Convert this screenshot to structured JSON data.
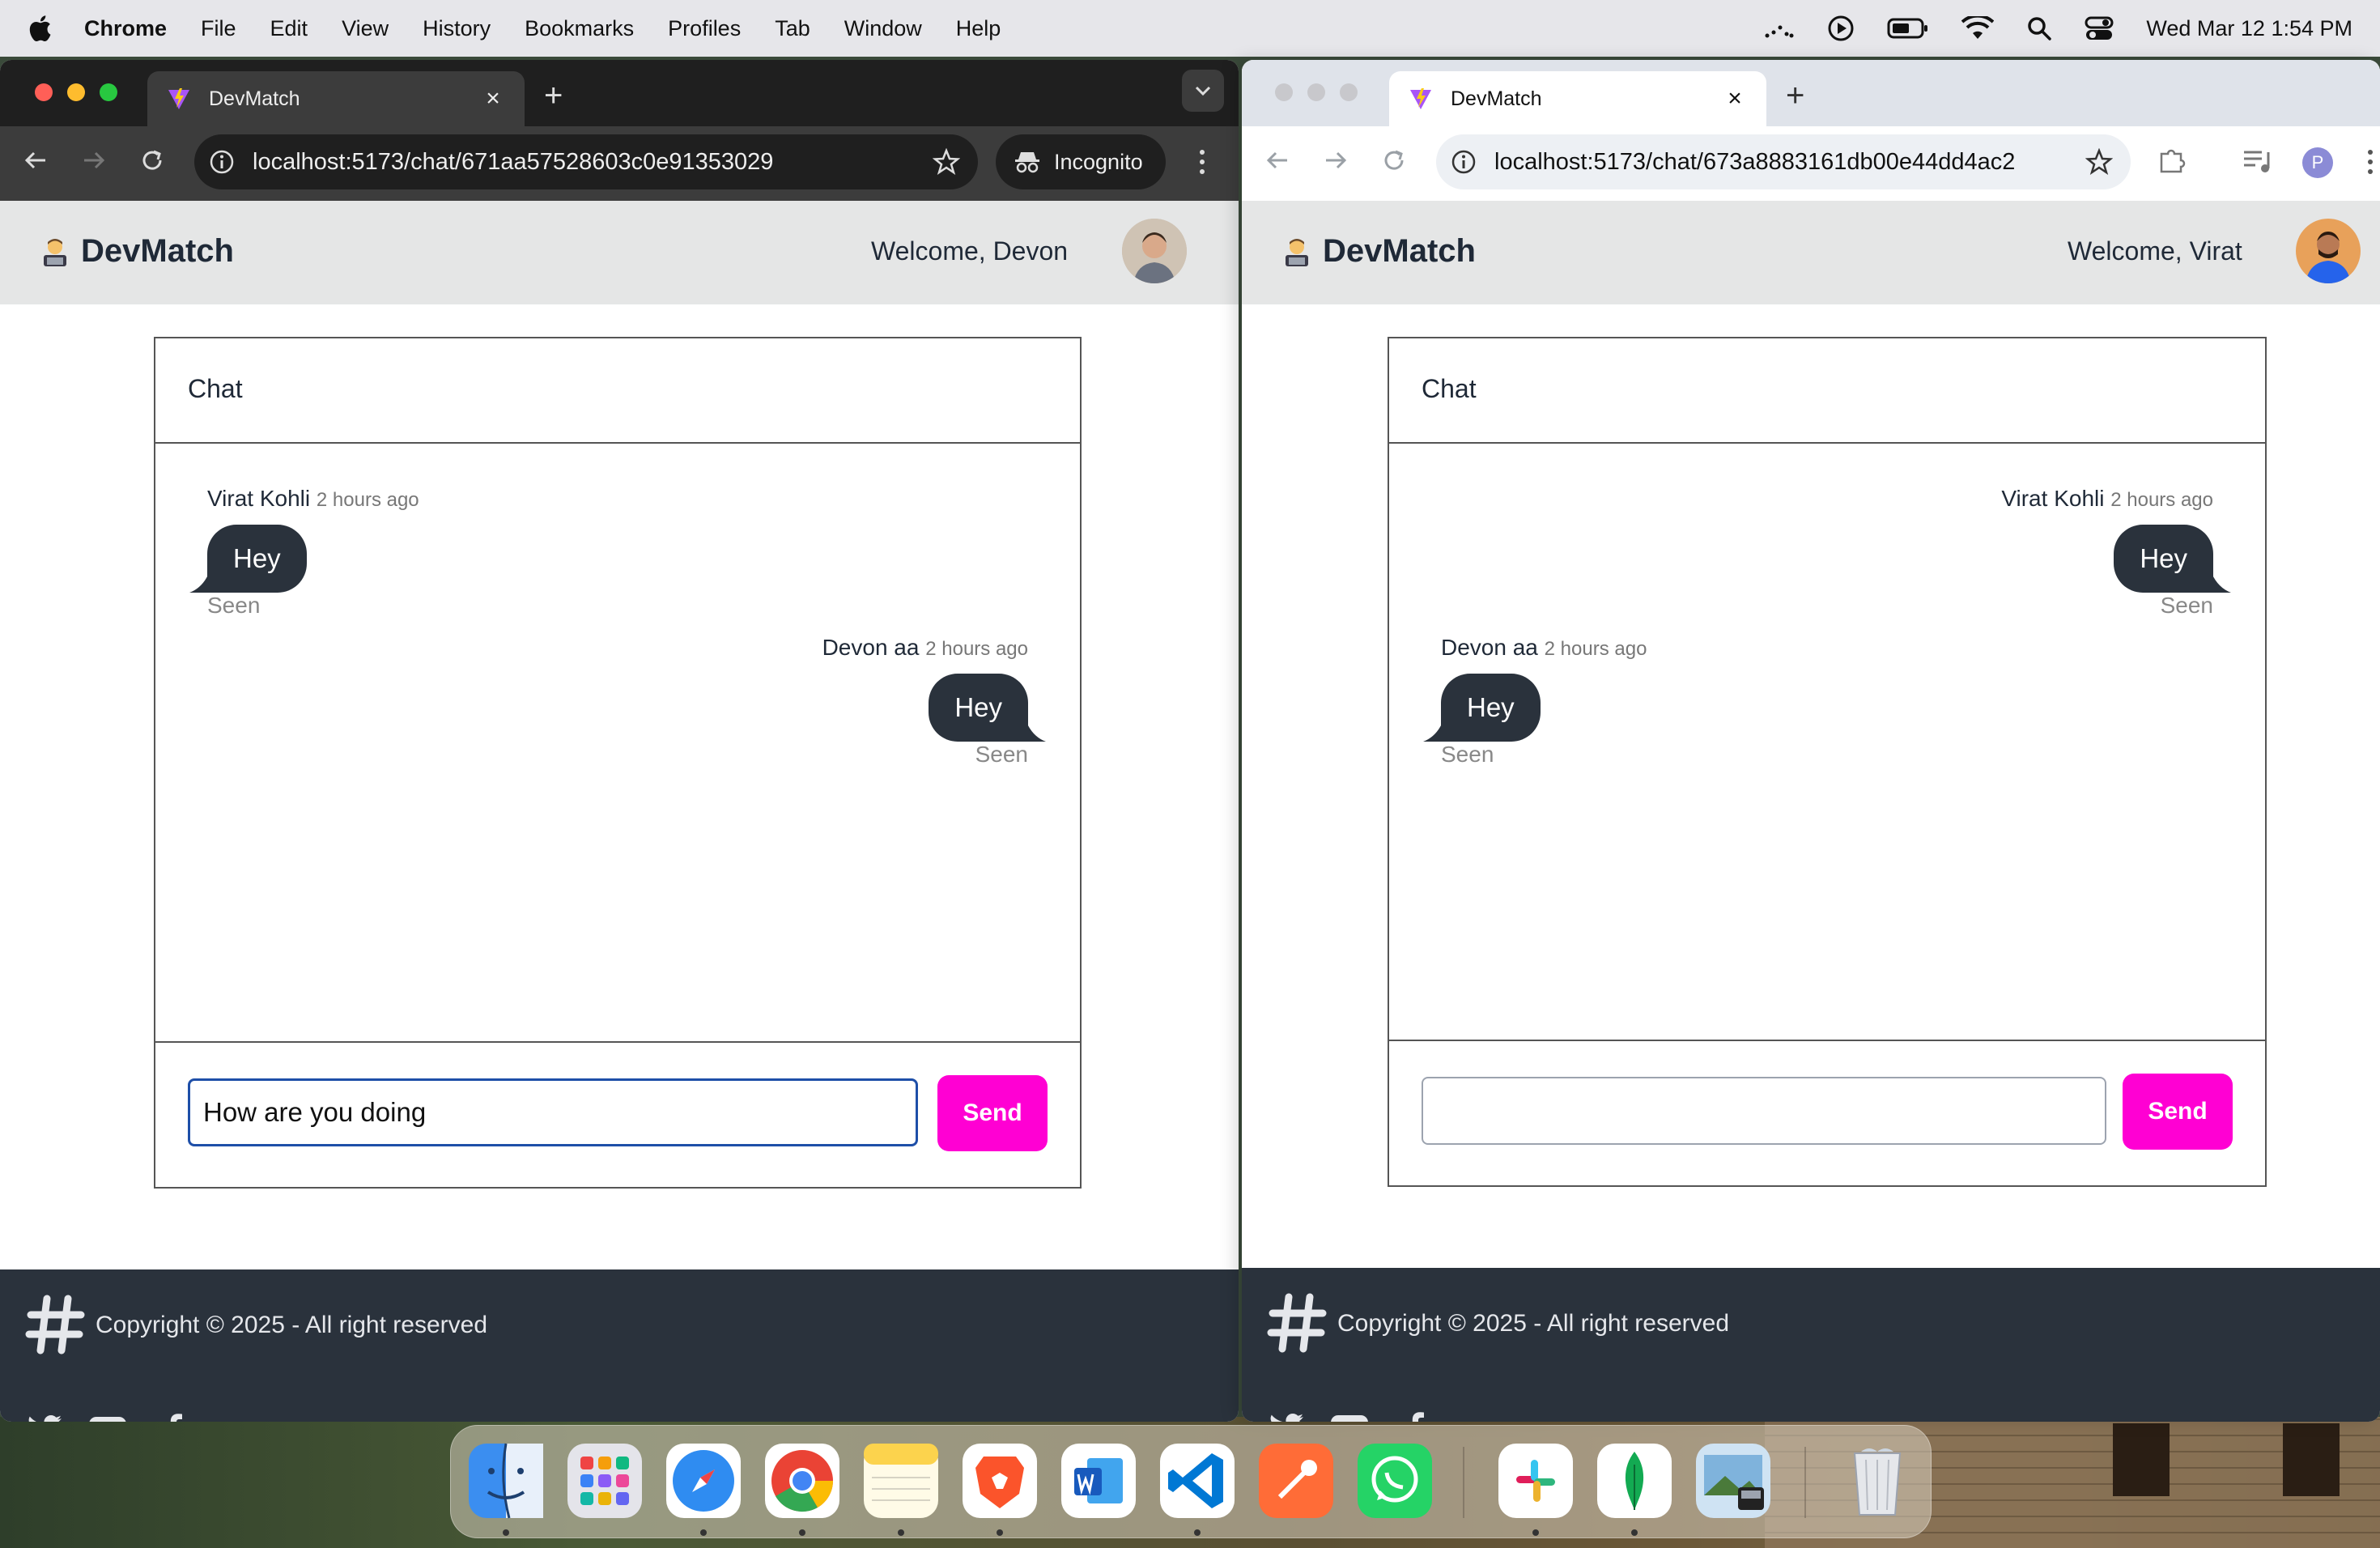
{
  "menubar": {
    "app": "Chrome",
    "items": [
      "File",
      "Edit",
      "View",
      "History",
      "Bookmarks",
      "Profiles",
      "Tab",
      "Window",
      "Help"
    ],
    "clock": "Wed Mar 12  1:54 PM"
  },
  "left_window": {
    "tab_title": "DevMatch",
    "url": "localhost:5173/chat/671aa57528603c0e91353029",
    "incognito_label": "Incognito",
    "brand": "DevMatch",
    "welcome": "Welcome, Devon",
    "chat_title": "Chat",
    "messages": [
      {
        "sender": "Virat Kohli",
        "time": "2 hours ago",
        "text": "Hey",
        "status": "Seen"
      },
      {
        "sender": "Devon aa",
        "time": "2 hours ago",
        "text": "Hey",
        "status": "Seen"
      }
    ],
    "input_value": "How are you doing",
    "send_label": "Send",
    "copyright": "Copyright © 2025 - All right reserved"
  },
  "right_window": {
    "tab_title": "DevMatch",
    "url": "localhost:5173/chat/673a8883161db00e44dd4ac2",
    "profile_initial": "P",
    "brand": "DevMatch",
    "welcome": "Welcome, Virat",
    "chat_title": "Chat",
    "messages": [
      {
        "sender": "Virat Kohli",
        "time": "2 hours ago",
        "text": "Hey",
        "status": "Seen"
      },
      {
        "sender": "Devon aa",
        "time": "2 hours ago",
        "text": "Hey",
        "status": "Seen"
      }
    ],
    "input_value": "",
    "send_label": "Send",
    "copyright": "Copyright © 2025 - All right reserved"
  },
  "dock": {
    "apps": [
      "finder-icon",
      "launchpad-icon",
      "safari-icon",
      "chrome-icon",
      "notes-icon",
      "brave-icon",
      "word-icon",
      "vscode-icon",
      "postman-icon",
      "whatsapp-icon",
      "slack-icon",
      "mongodb-icon",
      "preview-icon",
      "trash-icon"
    ]
  },
  "colors": {
    "send": "#ff00d3",
    "footer": "#2a323c",
    "bubble": "#2a323c",
    "navbar": "#e5e6e6"
  }
}
